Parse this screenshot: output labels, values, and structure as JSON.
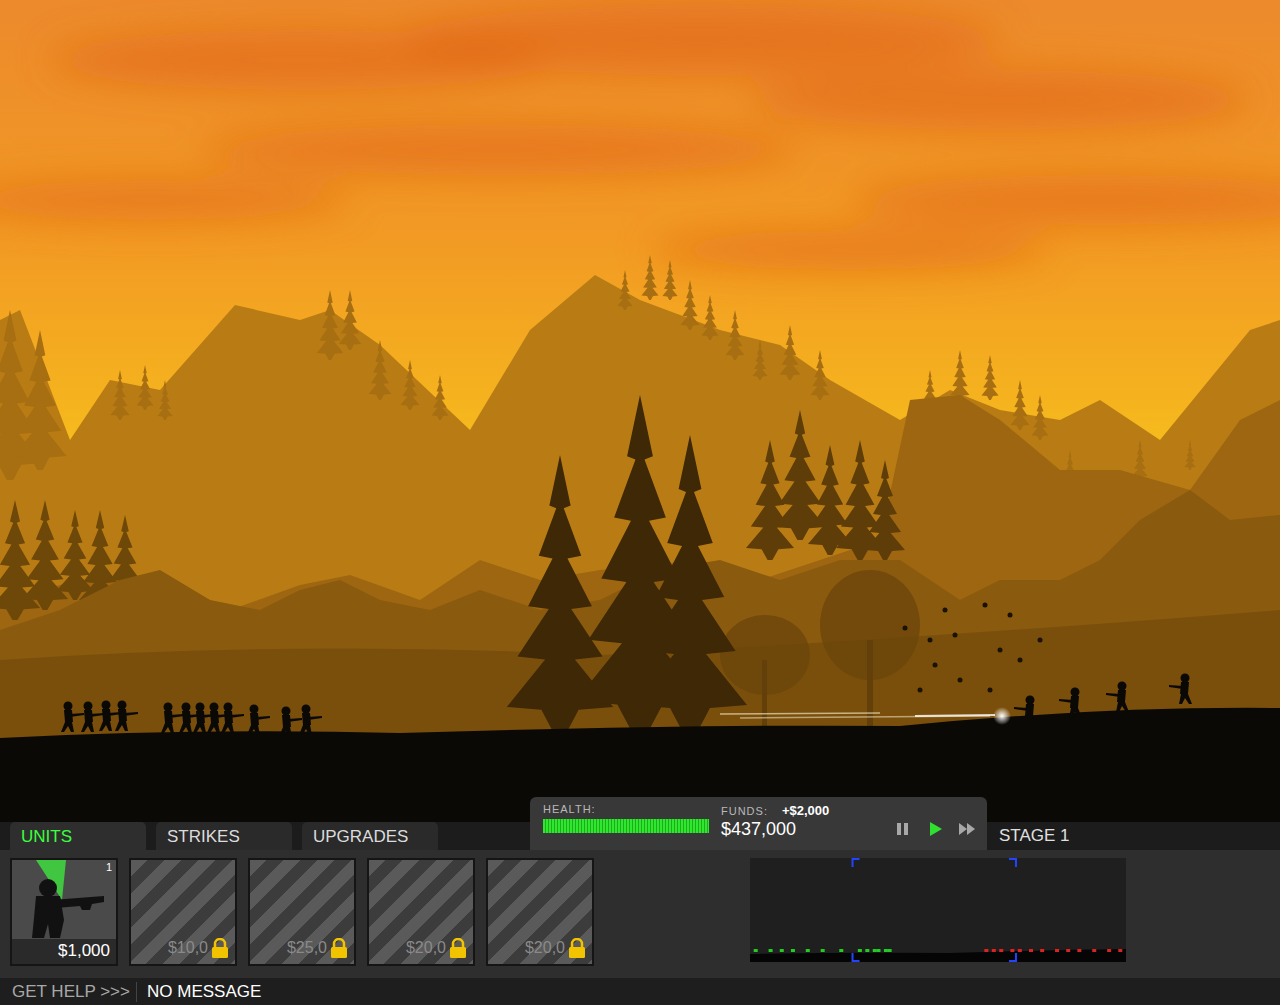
{
  "tabs": [
    {
      "label": "UNITS",
      "selected": true
    },
    {
      "label": "STRIKES",
      "selected": false
    },
    {
      "label": "UPGRADES",
      "selected": false
    }
  ],
  "hud": {
    "health": {
      "label": "HEALTH:",
      "level": 1.0
    },
    "funds": {
      "label": "FUNDS:",
      "income": "+$2,000",
      "amount": "$437,000"
    },
    "speed_buttons": [
      {
        "kind": "pause",
        "selected": false
      },
      {
        "kind": "play",
        "selected": true
      },
      {
        "kind": "fast",
        "selected": false
      }
    ]
  },
  "stage": "STAGE 1",
  "unit_slots": [
    {
      "count": "1",
      "price": "$1,000",
      "locked": false,
      "selected": true
    },
    {
      "price": "$10,0",
      "locked": true,
      "selected": false
    },
    {
      "price": "$25,0",
      "locked": true,
      "selected": false
    },
    {
      "price": "$20,0",
      "locked": true,
      "selected": false
    },
    {
      "price": "$20,0",
      "locked": true,
      "selected": false
    }
  ],
  "minimap": {
    "viewport": {
      "start": 0.27,
      "end": 0.71
    },
    "dots": [
      {
        "x": 0.01,
        "color": "#22cc22"
      },
      {
        "x": 0.05,
        "color": "#22cc22"
      },
      {
        "x": 0.08,
        "color": "#22cc22"
      },
      {
        "x": 0.11,
        "color": "#22cc22"
      },
      {
        "x": 0.15,
        "color": "#22cc22"
      },
      {
        "x": 0.19,
        "color": "#22cc22"
      },
      {
        "x": 0.24,
        "color": "#22cc22"
      },
      {
        "x": 0.29,
        "color": "#22cc22"
      },
      {
        "x": 0.31,
        "color": "#22cc22"
      },
      {
        "x": 0.33,
        "color": "#22cc22"
      },
      {
        "x": 0.34,
        "color": "#22cc22"
      },
      {
        "x": 0.36,
        "color": "#22cc22"
      },
      {
        "x": 0.37,
        "color": "#22cc22"
      },
      {
        "x": 0.63,
        "color": "#dd2222"
      },
      {
        "x": 0.65,
        "color": "#dd2222"
      },
      {
        "x": 0.67,
        "color": "#dd2222"
      },
      {
        "x": 0.7,
        "color": "#dd2222"
      },
      {
        "x": 0.72,
        "color": "#dd2222"
      },
      {
        "x": 0.75,
        "color": "#dd2222"
      },
      {
        "x": 0.78,
        "color": "#dd2222"
      },
      {
        "x": 0.82,
        "color": "#dd2222"
      },
      {
        "x": 0.85,
        "color": "#dd2222"
      },
      {
        "x": 0.88,
        "color": "#dd2222"
      },
      {
        "x": 0.92,
        "color": "#dd2222"
      },
      {
        "x": 0.96,
        "color": "#dd2222"
      },
      {
        "x": 0.99,
        "color": "#dd2222"
      }
    ]
  },
  "status_bar": {
    "help": "GET HELP >>>",
    "message": "NO MESSAGE"
  }
}
